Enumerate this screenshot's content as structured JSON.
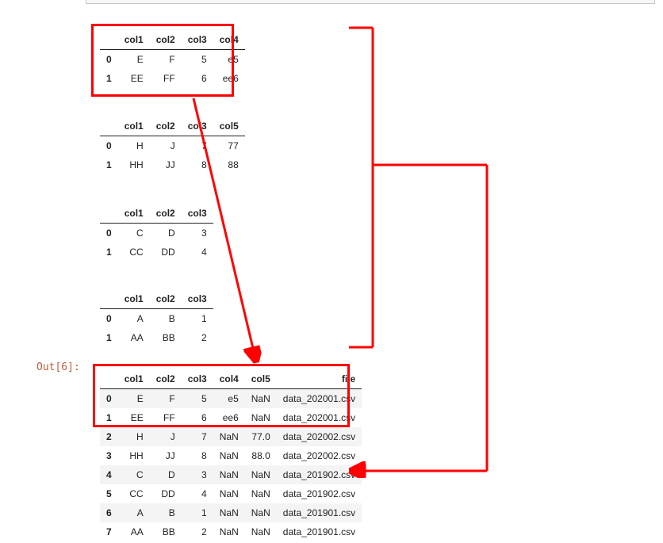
{
  "out_label": "Out[6]:",
  "tables": {
    "t1": {
      "headers": [
        "",
        "col1",
        "col2",
        "col3",
        "col4"
      ],
      "rows": [
        [
          "0",
          "E",
          "F",
          "5",
          "e5"
        ],
        [
          "1",
          "EE",
          "FF",
          "6",
          "ee6"
        ]
      ]
    },
    "t2": {
      "headers": [
        "",
        "col1",
        "col2",
        "col3",
        "col5"
      ],
      "rows": [
        [
          "0",
          "H",
          "J",
          "7",
          "77"
        ],
        [
          "1",
          "HH",
          "JJ",
          "8",
          "88"
        ]
      ]
    },
    "t3": {
      "headers": [
        "",
        "col1",
        "col2",
        "col3"
      ],
      "rows": [
        [
          "0",
          "C",
          "D",
          "3"
        ],
        [
          "1",
          "CC",
          "DD",
          "4"
        ]
      ]
    },
    "t4": {
      "headers": [
        "",
        "col1",
        "col2",
        "col3"
      ],
      "rows": [
        [
          "0",
          "A",
          "B",
          "1"
        ],
        [
          "1",
          "AA",
          "BB",
          "2"
        ]
      ]
    },
    "out": {
      "headers": [
        "",
        "col1",
        "col2",
        "col3",
        "col4",
        "col5",
        "file"
      ],
      "rows": [
        [
          "0",
          "E",
          "F",
          "5",
          "e5",
          "NaN",
          "data_202001.csv"
        ],
        [
          "1",
          "EE",
          "FF",
          "6",
          "ee6",
          "NaN",
          "data_202001.csv"
        ],
        [
          "2",
          "H",
          "J",
          "7",
          "NaN",
          "77.0",
          "data_202002.csv"
        ],
        [
          "3",
          "HH",
          "JJ",
          "8",
          "NaN",
          "88.0",
          "data_202002.csv"
        ],
        [
          "4",
          "C",
          "D",
          "3",
          "NaN",
          "NaN",
          "data_201902.csv"
        ],
        [
          "5",
          "CC",
          "DD",
          "4",
          "NaN",
          "NaN",
          "data_201902.csv"
        ],
        [
          "6",
          "A",
          "B",
          "1",
          "NaN",
          "NaN",
          "data_201901.csv"
        ],
        [
          "7",
          "AA",
          "BB",
          "2",
          "NaN",
          "NaN",
          "data_201901.csv"
        ]
      ]
    }
  }
}
